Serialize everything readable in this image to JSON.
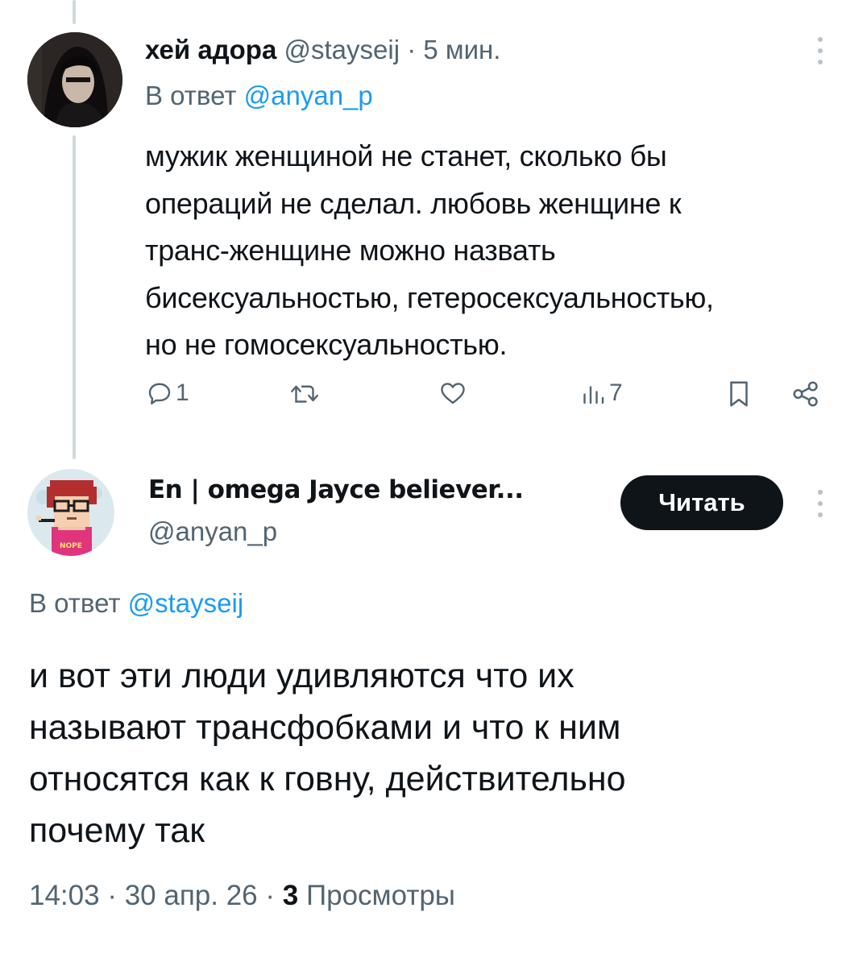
{
  "parent_tweet": {
    "display_name": "хей адора",
    "handle": "@stayseij",
    "separator": "·",
    "time": "5 мин.",
    "reply_prefix": "В ответ",
    "reply_handle": "@anyan_p",
    "text": "мужик женщиной не станет, сколько бы\nопераций не сделал. любовь женщине к\nтранс-женщине можно назвать\nбисексуальностью, гетеросексуальностью,\nно не гомосексуальностью.",
    "actions": {
      "reply_count": "1",
      "retweet_count": "",
      "like_count": "",
      "views_count": "7"
    },
    "avatar_icon": "dark-haired-person-avatar"
  },
  "main_tweet": {
    "display_name": "En | omega Jayce believer...",
    "handle": "@anyan_p",
    "follow_label": "Читать",
    "reply_prefix": "В ответ",
    "reply_handle": "@stayseij",
    "text": "и вот эти люди удивляются что их\nназывают трансфобками и что к ним\nотносятся как к говну, действительно\nпочему так",
    "avatar_icon": "pixel-art-glasses-boy-avatar",
    "avatar_badge": "NOPE",
    "meta": {
      "time": "14:03",
      "sep1": "·",
      "date": "30 апр. 26",
      "sep2": "·",
      "views": "3",
      "views_label": "Просмотры"
    }
  },
  "colors": {
    "text": "#0f1419",
    "muted": "#536471",
    "link": "#1d9bf0",
    "button_bg": "#0f1419",
    "thread_line": "#cfd9de"
  }
}
